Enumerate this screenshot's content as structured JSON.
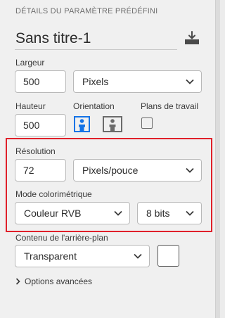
{
  "header": {
    "section_title": "DÉTAILS DU PARAMÈTRE PRÉDÉFINI",
    "preset_name": "Sans titre-1"
  },
  "width": {
    "label": "Largeur",
    "value": "500",
    "unit": "Pixels"
  },
  "height": {
    "label": "Hauteur",
    "value": "500"
  },
  "orientation": {
    "label": "Orientation",
    "selected": "portrait"
  },
  "artboards": {
    "label": "Plans de travail",
    "checked": false
  },
  "resolution": {
    "label": "Résolution",
    "value": "72",
    "unit": "Pixels/pouce"
  },
  "color_mode": {
    "label": "Mode colorimétrique",
    "mode": "Couleur RVB",
    "depth": "8 bits"
  },
  "background": {
    "label": "Contenu de l'arrière-plan",
    "value": "Transparent",
    "swatch_color": "#ffffff"
  },
  "advanced": {
    "label": "Options avancées"
  },
  "colors": {
    "highlight": "#e0202a",
    "accent": "#1473e6"
  }
}
